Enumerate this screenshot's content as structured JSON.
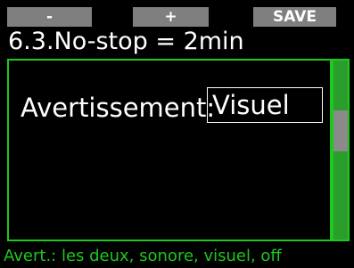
{
  "softkeys": {
    "minus": "-",
    "plus": "+",
    "save": "SAVE"
  },
  "header": {
    "title": "6.3.No-stop = 2min"
  },
  "setting": {
    "label": "Avertissement:",
    "value": "Visuel"
  },
  "footer": {
    "hint": "Avert.: les deux, sonore, visuel, off"
  },
  "colors": {
    "accent_green": "#1ec81e",
    "scroll_green": "#2a9d2a",
    "softkey_gray": "#7f7f7f",
    "background": "#000000"
  }
}
